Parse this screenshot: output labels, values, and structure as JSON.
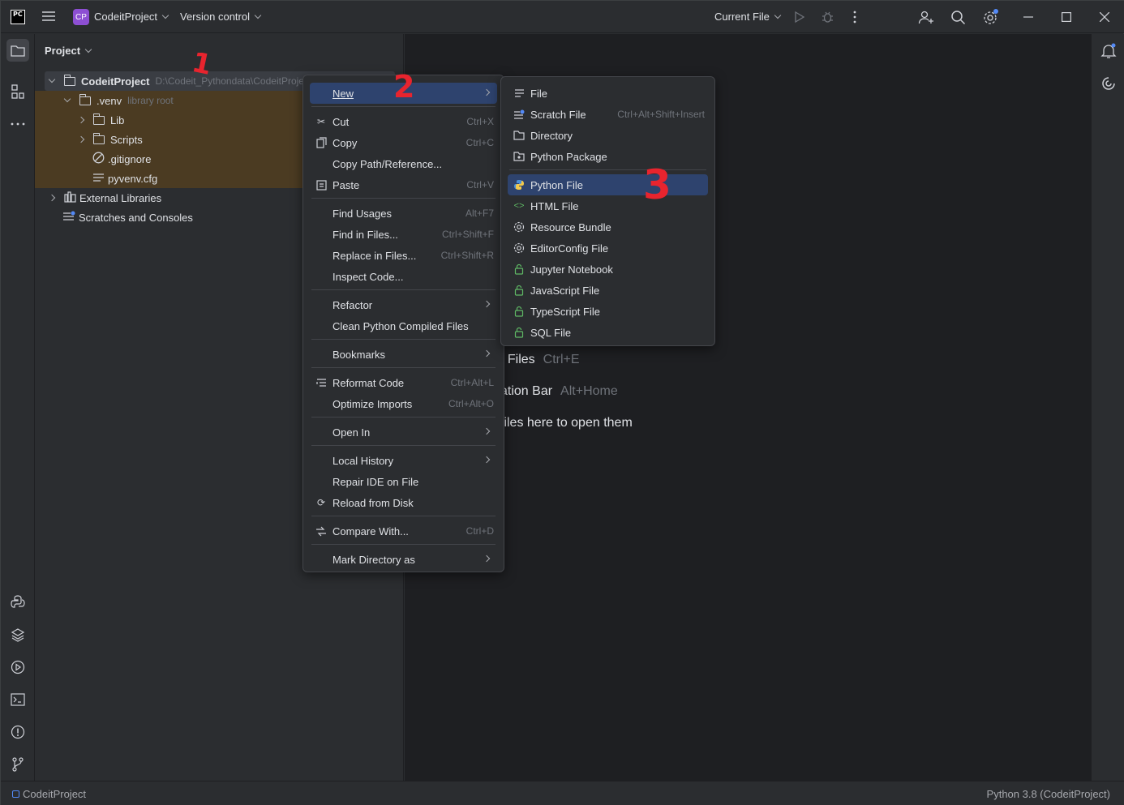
{
  "titlebar": {
    "logo": "PC",
    "project_badge": "CP",
    "project_name": "CodeitProject",
    "vcs": "Version control",
    "run_config": "Current File"
  },
  "project_panel": {
    "title": "Project",
    "tree": [
      {
        "label": "CodeitProject",
        "hint": "D:\\Codeit_Pythondata\\CodeitProje",
        "bold": true
      },
      {
        "label": ".venv",
        "hint": "library root"
      },
      {
        "label": "Lib"
      },
      {
        "label": "Scripts"
      },
      {
        "label": ".gitignore"
      },
      {
        "label": "pyvenv.cfg"
      },
      {
        "label": "External Libraries"
      },
      {
        "label": "Scratches and Consoles"
      }
    ]
  },
  "context_menu": {
    "items": [
      {
        "label": "New",
        "shortcut": "",
        "submenu": true
      },
      {
        "label": "Cut",
        "shortcut": "Ctrl+X",
        "icon": "scissors-icon"
      },
      {
        "label": "Copy",
        "shortcut": "Ctrl+C",
        "icon": "copy-icon"
      },
      {
        "label": "Copy Path/Reference...",
        "shortcut": ""
      },
      {
        "label": "Paste",
        "shortcut": "Ctrl+V",
        "icon": "paste-icon"
      },
      {
        "label": "Find Usages",
        "shortcut": "Alt+F7"
      },
      {
        "label": "Find in Files...",
        "shortcut": "Ctrl+Shift+F"
      },
      {
        "label": "Replace in Files...",
        "shortcut": "Ctrl+Shift+R"
      },
      {
        "label": "Inspect Code...",
        "shortcut": ""
      },
      {
        "label": "Refactor",
        "shortcut": "",
        "submenu": true
      },
      {
        "label": "Clean Python Compiled Files",
        "shortcut": ""
      },
      {
        "label": "Bookmarks",
        "shortcut": "",
        "submenu": true
      },
      {
        "label": "Reformat Code",
        "shortcut": "Ctrl+Alt+L",
        "icon": "reformat-icon"
      },
      {
        "label": "Optimize Imports",
        "shortcut": "Ctrl+Alt+O"
      },
      {
        "label": "Open In",
        "shortcut": "",
        "submenu": true
      },
      {
        "label": "Local History",
        "shortcut": "",
        "submenu": true
      },
      {
        "label": "Repair IDE on File",
        "shortcut": ""
      },
      {
        "label": "Reload from Disk",
        "shortcut": "",
        "icon": "reload-icon"
      },
      {
        "label": "Compare With...",
        "shortcut": "Ctrl+D",
        "icon": "compare-icon"
      },
      {
        "label": "Mark Directory as",
        "shortcut": "",
        "submenu": true
      }
    ]
  },
  "new_submenu": {
    "items": [
      {
        "label": "File",
        "shortcut": ""
      },
      {
        "label": "Scratch File",
        "shortcut": "Ctrl+Alt+Shift+Insert"
      },
      {
        "label": "Directory",
        "shortcut": ""
      },
      {
        "label": "Python Package",
        "shortcut": ""
      },
      {
        "label": "Python File",
        "shortcut": ""
      },
      {
        "label": "HTML File",
        "shortcut": ""
      },
      {
        "label": "Resource Bundle",
        "shortcut": ""
      },
      {
        "label": "EditorConfig File",
        "shortcut": ""
      },
      {
        "label": "Jupyter Notebook",
        "shortcut": ""
      },
      {
        "label": "JavaScript File",
        "shortcut": ""
      },
      {
        "label": "TypeScript File",
        "shortcut": ""
      },
      {
        "label": "SQL File",
        "shortcut": ""
      }
    ]
  },
  "editor": {
    "hints": [
      {
        "text": "t Files",
        "key": "Ctrl+E"
      },
      {
        "text": "ation Bar",
        "key": "Alt+Home"
      },
      {
        "text": "files here to open them",
        "key": ""
      }
    ]
  },
  "annotations": [
    "1",
    "2",
    "3"
  ],
  "statusbar": {
    "project": "CodeitProject",
    "interpreter": "Python 3.8 (CodeitProject)"
  },
  "colors": {
    "selection": "#2e436e",
    "panel": "#2b2d30",
    "editor": "#1e1f22",
    "venv_highlight": "#4b3b22",
    "badge": "#8d4fd3",
    "annotation": "#e8242e"
  }
}
